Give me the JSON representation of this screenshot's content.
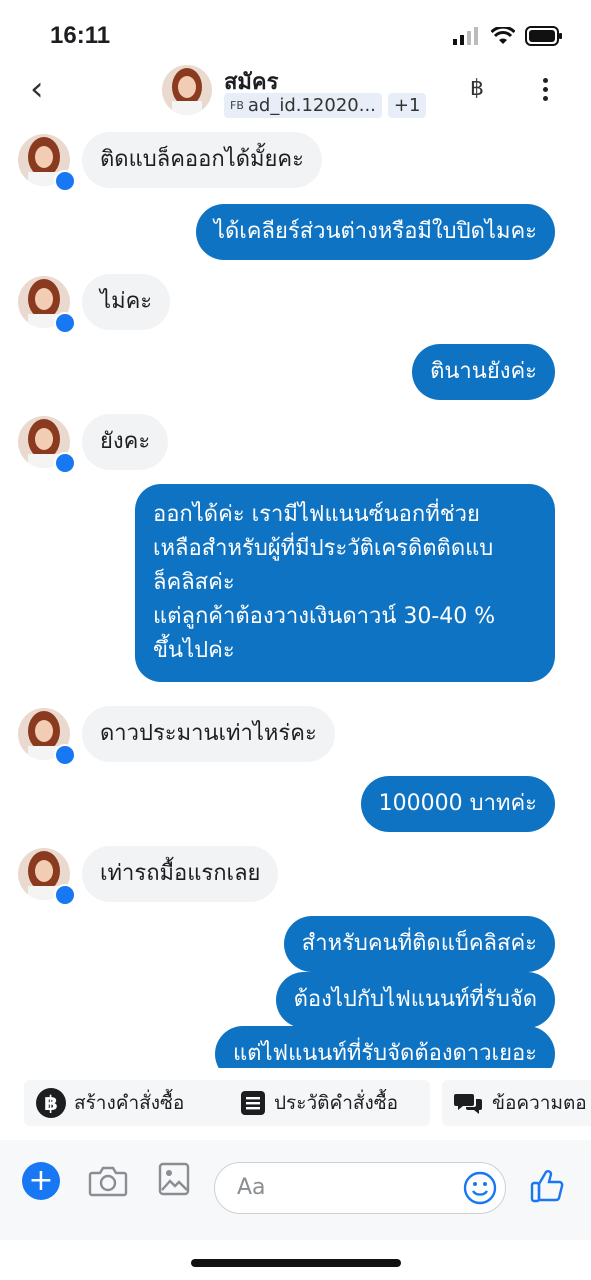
{
  "status": {
    "time": "16:11"
  },
  "header": {
    "name": "สมัคร",
    "ad_prefix": "FB",
    "ad_id": "ad_id.12020...",
    "extra": "+1",
    "baht": "฿"
  },
  "messages": [
    {
      "dir": "in",
      "text": "ติดแบล็คออกได้มั้ยคะ"
    },
    {
      "dir": "out",
      "text": "ได้เคลียร์ส่วนต่างหรือมีใบปิดไมคะ"
    },
    {
      "dir": "in",
      "text": "ไม่คะ"
    },
    {
      "dir": "out",
      "text": "ตินานยังค่ะ"
    },
    {
      "dir": "in",
      "text": "ยังคะ"
    },
    {
      "dir": "out",
      "lines": [
        "ออกได้ค่ะ เรามีไฟแนนซ์นอกที่ช่วย",
        "เหลือสำหรับผู้ที่มีประวัติเครดิตติดแบ",
        "ล็คลิสค่ะ",
        "แต่ลูกค้าต้องวางเงินดาวน์ 30-40 %",
        "ขึ้นไปค่ะ"
      ]
    },
    {
      "dir": "in",
      "text": "ดาวประมานเท่าไหร่คะ"
    },
    {
      "dir": "out",
      "text": "100000 บาทค่ะ"
    },
    {
      "dir": "in",
      "text": "เท่ารถมื้อแรกเลย"
    },
    {
      "dir": "out",
      "text": "สำหรับคนที่ติดแบ็คลิสค่ะ"
    },
    {
      "dir": "out",
      "text": "ต้องไปกับไฟแนนท์ที่รับจัด"
    },
    {
      "dir": "out",
      "text": "แต่ไฟแนนท์ที่รับจัดต้องดาวเยอะ"
    }
  ],
  "actions": [
    {
      "label": "สร้างคำสั่งซื้อ",
      "icon": "baht-circle-icon"
    },
    {
      "label": "ประวัติคำสั่งซื้อ",
      "icon": "list-icon"
    },
    {
      "label": "ข้อความตอ",
      "icon": "chat-bubbles-icon"
    }
  ],
  "composer": {
    "placeholder": "Aa"
  },
  "colors": {
    "outgoing": "#0f73c4",
    "incoming": "#f2f3f5",
    "accent": "#1877f2"
  }
}
